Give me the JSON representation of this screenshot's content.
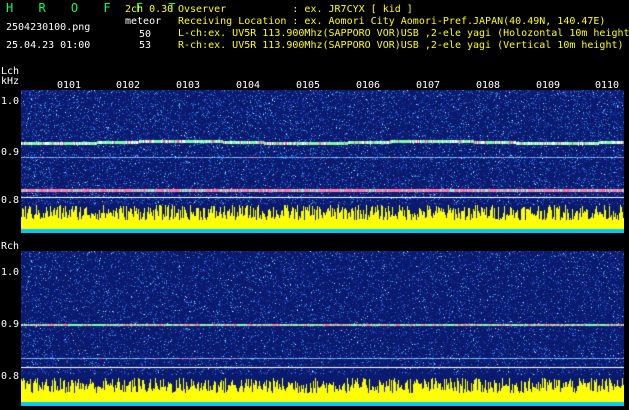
{
  "header": {
    "app_name": "H R O F F T",
    "version": "2ch 0.30",
    "mode": "meteor",
    "filename": "2504230100.png",
    "datetime": "25.04.23 01:00",
    "lch_count": "50",
    "rch_count": "53",
    "observer_line": "Ovserver           : ex. JR7CYX [ kid ]",
    "location_line": "Receiving Location : ex. Aomori City Aomori-Pref.JAPAN(40.49N, 140.47E)",
    "lch_line": "L-ch:ex. UV5R 113.900Mhz(SAPPORO VOR)USB ,2-ele yagi (Holozontal 10m height",
    "rch_line": "R-ch:ex. UV5R 113.900Mhz(SAPPORO VOR)USB ,2-ele yagi (Vertical 10m height)"
  },
  "lch_panel": {
    "channel_label": "Lch",
    "unit_label": "kHz",
    "y_ticks": [
      "1.0",
      "0.9",
      "0.8"
    ],
    "time_ticks": [
      "0101",
      "0102",
      "0103",
      "0104",
      "0105",
      "0106",
      "0107",
      "0108",
      "0109",
      "0110"
    ]
  },
  "rch_panel": {
    "channel_label": "Rch",
    "y_ticks": [
      "1.0",
      "0.9",
      "0.8"
    ]
  },
  "colors": {
    "background": "#000000",
    "spectrum_bg": "#0c1e78",
    "trace_bright": "#7fffa0",
    "level_bar": "#ffff00",
    "level_base": "#00c8ff"
  }
}
